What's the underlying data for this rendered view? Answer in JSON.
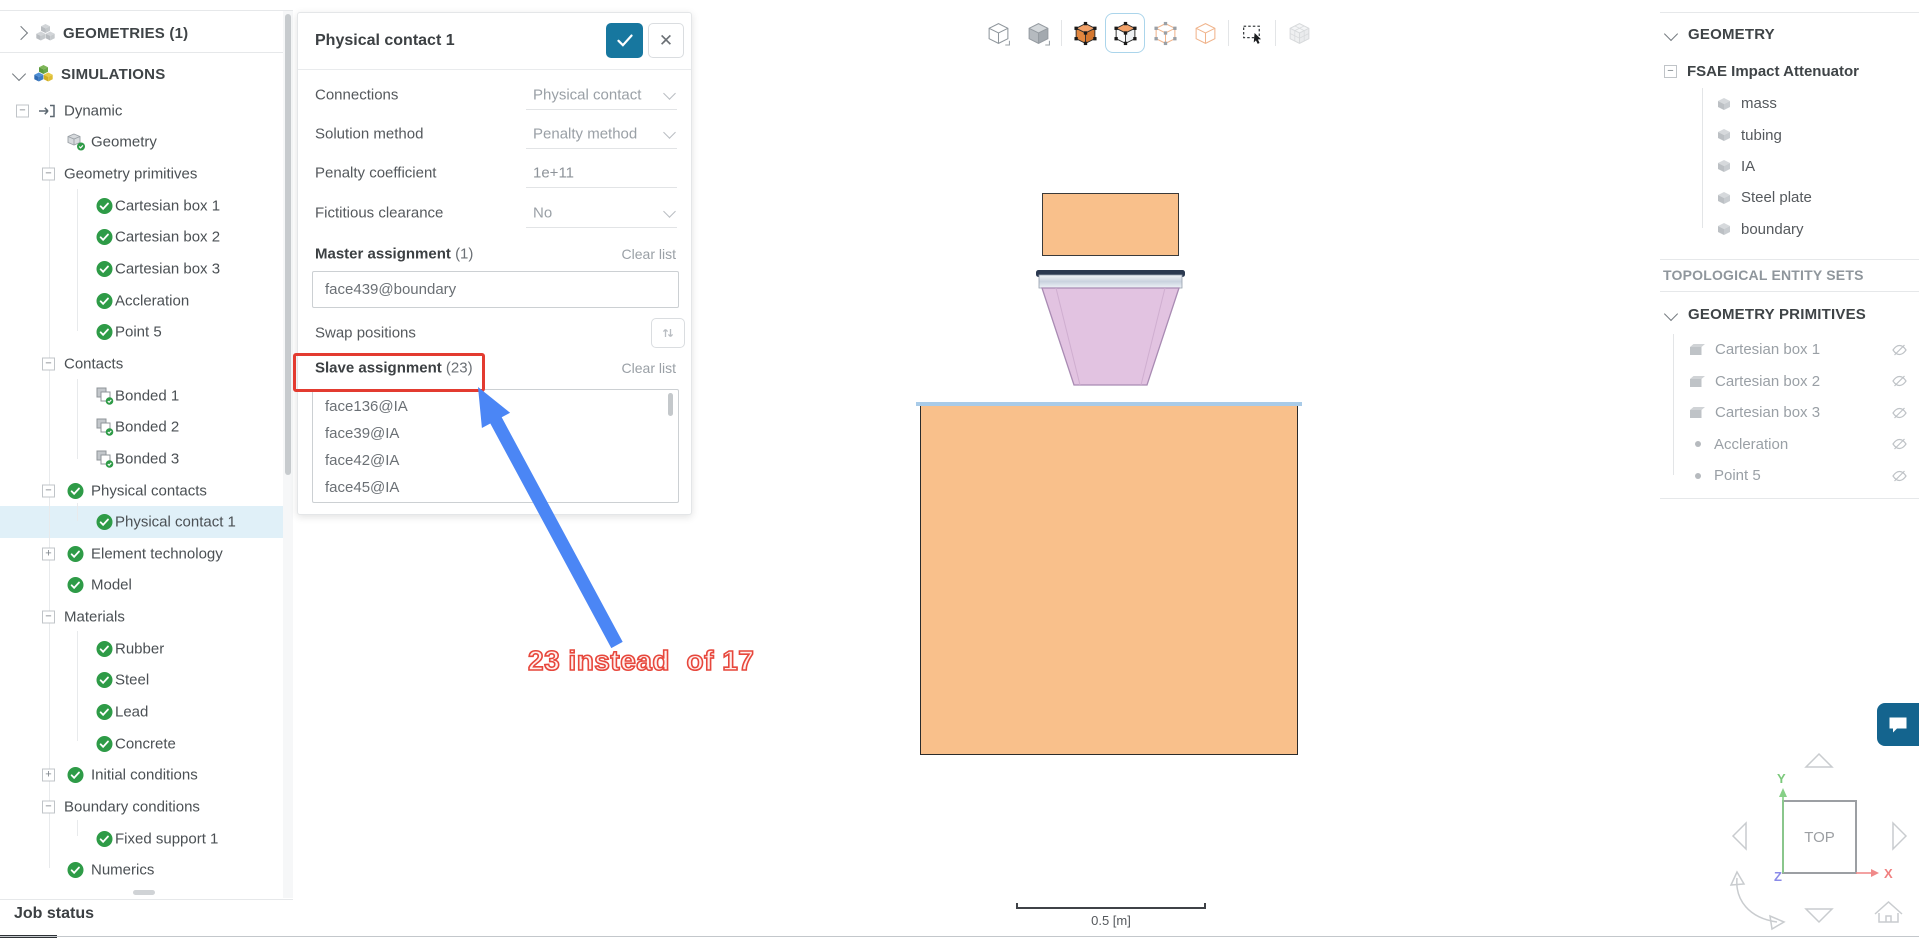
{
  "left_sidebar": {
    "geometries_label": "GEOMETRIES (1)",
    "simulations_label": "SIMULATIONS",
    "tree": [
      {
        "label": "Dynamic",
        "depth": 1,
        "icon": "arrowIn",
        "exp": "minus"
      },
      {
        "label": "Geometry",
        "depth": 2,
        "icon": "cubeCheck"
      },
      {
        "label": "Geometry primitives",
        "depth": 2,
        "exp": "minus"
      },
      {
        "label": "Cartesian box 1",
        "depth": 3,
        "icon": "check"
      },
      {
        "label": "Cartesian box 2",
        "depth": 3,
        "icon": "check"
      },
      {
        "label": "Cartesian box 3",
        "depth": 3,
        "icon": "check"
      },
      {
        "label": "Accleration",
        "depth": 3,
        "icon": "check"
      },
      {
        "label": "Point 5",
        "depth": 3,
        "icon": "check"
      },
      {
        "label": "Contacts",
        "depth": 2,
        "exp": "minus"
      },
      {
        "label": "Bonded 1",
        "depth": 3,
        "icon": "bonded"
      },
      {
        "label": "Bonded 2",
        "depth": 3,
        "icon": "bonded"
      },
      {
        "label": "Bonded 3",
        "depth": 3,
        "icon": "bonded"
      },
      {
        "label": "Physical contacts",
        "depth": 2,
        "icon": "check",
        "exp": "minus"
      },
      {
        "label": "Physical contact 1",
        "depth": 3,
        "icon": "check",
        "sel": true
      },
      {
        "label": "Element technology",
        "depth": 2,
        "icon": "check",
        "exp": "plus"
      },
      {
        "label": "Model",
        "depth": 2,
        "icon": "check"
      },
      {
        "label": "Materials",
        "depth": 2,
        "exp": "minus"
      },
      {
        "label": "Rubber",
        "depth": 3,
        "icon": "check"
      },
      {
        "label": "Steel",
        "depth": 3,
        "icon": "check"
      },
      {
        "label": "Lead",
        "depth": 3,
        "icon": "check"
      },
      {
        "label": "Concrete",
        "depth": 3,
        "icon": "check"
      },
      {
        "label": "Initial conditions",
        "depth": 2,
        "icon": "check",
        "exp": "plus"
      },
      {
        "label": "Boundary conditions",
        "depth": 2,
        "exp": "minus"
      },
      {
        "label": "Fixed support 1",
        "depth": 3,
        "icon": "check"
      },
      {
        "label": "Numerics",
        "depth": 2,
        "icon": "check"
      }
    ],
    "job_status_label": "Job status"
  },
  "dialog": {
    "title": "Physical contact 1",
    "fields": [
      {
        "label": "Connections",
        "value": "Physical contact",
        "type": "select"
      },
      {
        "label": "Solution method",
        "value": "Penalty method",
        "type": "select"
      },
      {
        "label": "Penalty coefficient",
        "value": "1e+11",
        "type": "input"
      },
      {
        "label": "Fictitious clearance",
        "value": "No",
        "type": "select"
      }
    ],
    "master": {
      "label": "Master assignment",
      "count": "(1)",
      "clear": "Clear list",
      "items": [
        "face439@boundary"
      ]
    },
    "swap_label": "Swap positions",
    "slave": {
      "label": "Slave assignment",
      "count": "(23)",
      "clear": "Clear list",
      "items": [
        "face136@IA",
        "face39@IA",
        "face42@IA",
        "face45@IA"
      ]
    }
  },
  "toolbar": {
    "icons": [
      "wireframe-cube",
      "shaded-cube",
      "solid-orange-cube",
      "orange-face-cube",
      "faint-vertex-cube",
      "faint-cube",
      "box-select",
      "mesh-cube"
    ],
    "selected_index": 3
  },
  "right_panel": {
    "geometry_header": "GEOMETRY",
    "root": "FSAE Impact Attenuator",
    "parts": [
      "mass",
      "tubing",
      "IA",
      "Steel plate",
      "boundary"
    ],
    "topo_header": "TOPOLOGICAL ENTITY SETS",
    "prim_header": "GEOMETRY PRIMITIVES",
    "primitives": [
      {
        "label": "Cartesian box 1",
        "icon": "box"
      },
      {
        "label": "Cartesian box 2",
        "icon": "box"
      },
      {
        "label": "Cartesian box 3",
        "icon": "box"
      },
      {
        "label": "Accleration",
        "icon": "point"
      },
      {
        "label": "Point 5",
        "icon": "point"
      }
    ]
  },
  "viewport": {
    "annotation": "23 instead  of 17",
    "scale_label": "0.5 [m]",
    "cube_label": "TOP",
    "axes": {
      "x": "X",
      "y": "Y",
      "z": "Z"
    }
  },
  "colors": {
    "accent_blue": "#17779f",
    "selection_blue": "#e0f0f8",
    "check_green": "#2e9b47",
    "highlight_red": "#e7473c",
    "arrow_blue": "#4b86f5",
    "model_orange": "#f9c08b",
    "model_pink": "#e2c3e1"
  },
  "icons": {
    "check-icon": "green circle with white checkmark",
    "bonded-contact-icon": "two overlapping squares with green check badge",
    "cube-check-icon": "gray cube with green check badge",
    "dynamic-analysis-icon": "arrow into bracket",
    "geometries-icon": "three gray cubes",
    "simulations-icon": "three colored cubes",
    "part-cube-icon": "gray shaded cube",
    "primitive-box-icon": "gray box",
    "primitive-point-icon": "gray dot",
    "visibility-off-icon": "crossed-out eye",
    "confirm-icon": "white checkmark",
    "close-icon": "x mark",
    "swap-icon": "up and down arrows",
    "chat-icon": "speech bubble",
    "home-icon": "house outline",
    "rotate-icon": "curved double arrow"
  }
}
